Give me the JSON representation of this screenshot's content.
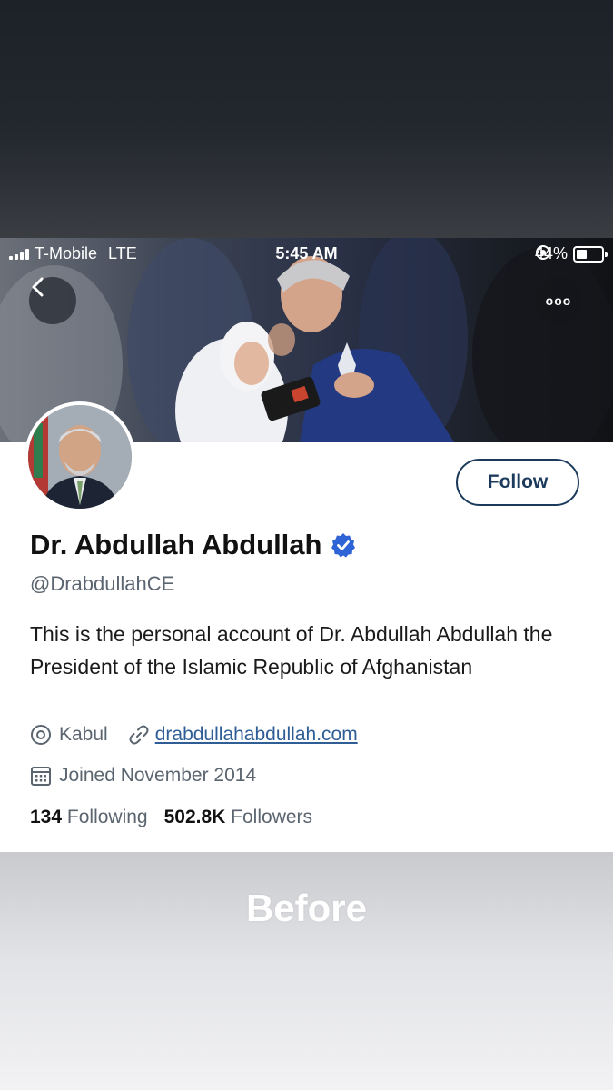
{
  "status_bar": {
    "carrier": "T-Mobile",
    "network": "LTE",
    "time": "5:45 AM",
    "battery": "44%",
    "battery_level": 0.44
  },
  "profile": {
    "follow_label": "Follow",
    "display_name": "Dr. Abdullah Abdullah",
    "verified": true,
    "handle": "@DrabdullahCE",
    "bio": "This is the personal account of Dr. Abdullah Abdullah the President of the Islamic Republic of Afghanistan",
    "location": "Kabul",
    "website": "drabdullahabdullah.com",
    "joined": "Joined November 2014",
    "following_count": "134",
    "following_label": "Following",
    "followers_count": "502.8K",
    "followers_label": "Followers"
  },
  "nav": {
    "more_label": "ooo"
  },
  "caption": "Before",
  "colors": {
    "verified_badge": "#2f64d6",
    "follow_border": "#1c3b5c",
    "link": "#2f5e97",
    "secondary_text": "#5b6570"
  },
  "icons": [
    "signal-icon",
    "battery-icon",
    "back-arrow-icon",
    "more-icon",
    "verified-badge-icon",
    "location-pin-icon",
    "link-icon",
    "calendar-icon"
  ]
}
